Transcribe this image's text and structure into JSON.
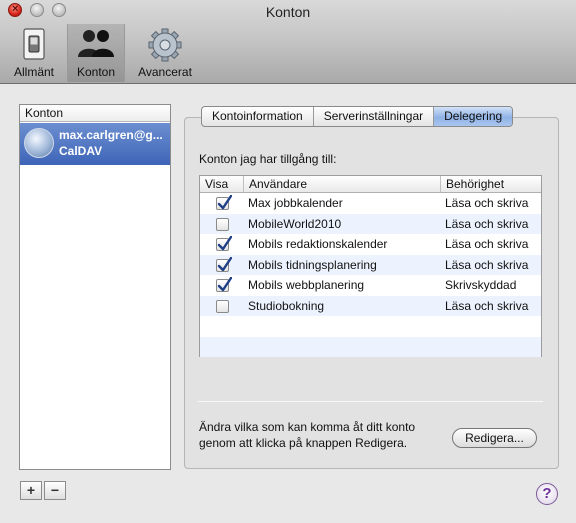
{
  "window": {
    "title": "Konton"
  },
  "toolbar": {
    "items": [
      {
        "label": "Allmänt",
        "icon": "general-switch-icon"
      },
      {
        "label": "Konton",
        "icon": "people-icon",
        "selected": true
      },
      {
        "label": "Avancerat",
        "icon": "gear-icon"
      }
    ]
  },
  "sidebar": {
    "header": "Konton",
    "accounts": [
      {
        "email": "max.carlgren@g...",
        "type": "CalDAV",
        "icon": "calendar-globe-icon",
        "selected": true
      }
    ],
    "add_label": "+",
    "remove_label": "−"
  },
  "tabs": [
    {
      "label": "Kontoinformation",
      "active": false
    },
    {
      "label": "Serverinställningar",
      "active": false
    },
    {
      "label": "Delegering",
      "active": true
    }
  ],
  "delegation": {
    "label": "Konton jag har tillgång till:",
    "columns": [
      "Visa",
      "Användare",
      "Behörighet"
    ],
    "rows": [
      {
        "checked": true,
        "user": "Max jobbkalender",
        "permission": "Läsa och skriva"
      },
      {
        "checked": false,
        "user": "MobileWorld2010",
        "permission": "Läsa och skriva"
      },
      {
        "checked": true,
        "user": "Mobils redaktionskalender",
        "permission": "Läsa och skriva"
      },
      {
        "checked": true,
        "user": "Mobils tidningsplanering",
        "permission": "Läsa och skriva"
      },
      {
        "checked": true,
        "user": "Mobils webbplanering",
        "permission": "Skrivskyddad"
      },
      {
        "checked": false,
        "user": "Studiobokning",
        "permission": "Läsa och skriva"
      }
    ],
    "hint": "Ändra vilka som kan komma åt ditt konto genom att klicka på knappen Redigera.",
    "edit_label": "Redigera..."
  },
  "help_label": "?",
  "colors": {
    "selection": "#3e64b8",
    "tab_active": "#8fb2e6",
    "checkmark": "#1f3f86"
  }
}
